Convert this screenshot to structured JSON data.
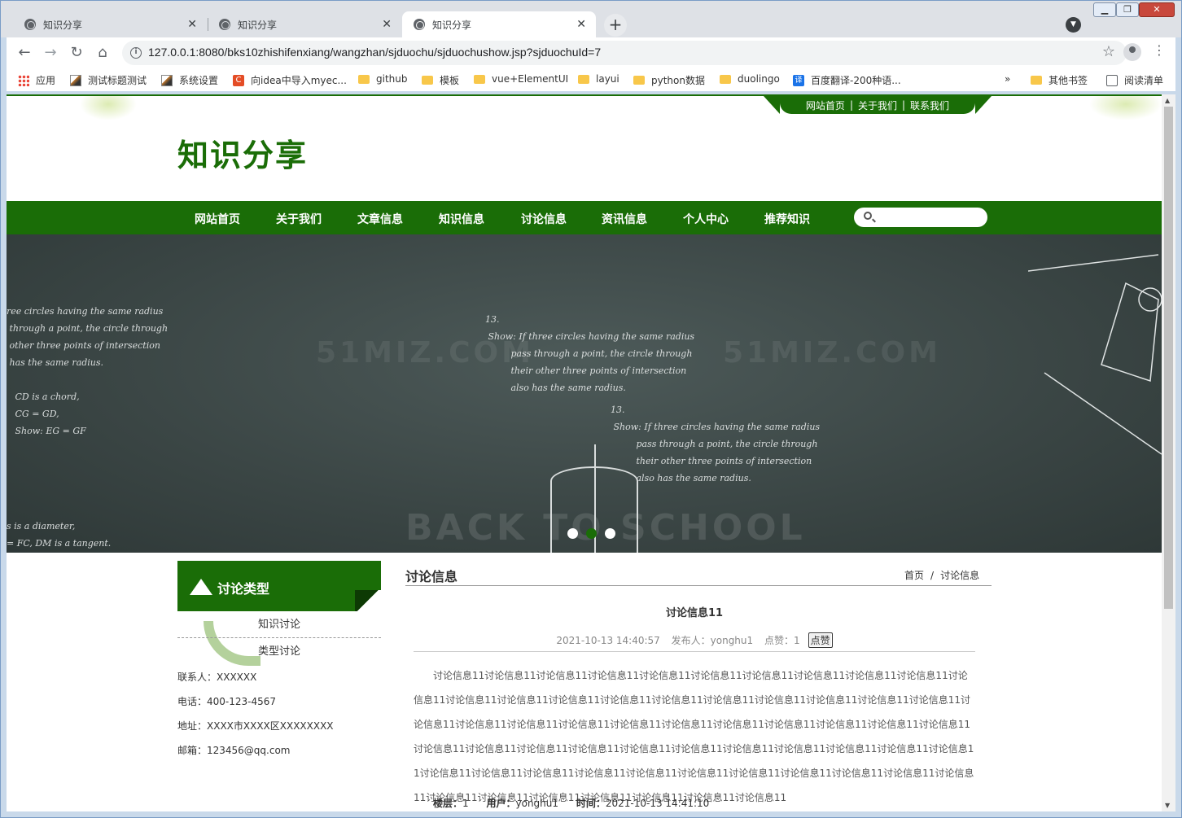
{
  "browser": {
    "tabs": [
      {
        "title": "知识分享"
      },
      {
        "title": "知识分享"
      },
      {
        "title": "知识分享"
      }
    ],
    "url": "127.0.0.1:8080/bks10zhishifenxiang/wangzhan/sjduochu/sjduochushow.jsp?sjduochuId=7",
    "bookmarks": [
      {
        "label": "应用",
        "icon": "apps-icon"
      },
      {
        "label": "测试标题测试",
        "icon": "image-icon"
      },
      {
        "label": "系统设置",
        "icon": "image-icon"
      },
      {
        "label": "向idea中导入myec...",
        "icon": "c-icon"
      },
      {
        "label": "github",
        "icon": "folder-icon"
      },
      {
        "label": "模板",
        "icon": "folder-icon"
      },
      {
        "label": "vue+ElementUI",
        "icon": "folder-icon"
      },
      {
        "label": "layui",
        "icon": "folder-icon"
      },
      {
        "label": "python数据",
        "icon": "folder-icon"
      },
      {
        "label": "duolingo",
        "icon": "folder-icon"
      },
      {
        "label": "百度翻译-200种语...",
        "icon": "translate-icon"
      }
    ],
    "overflow": "»",
    "other_bookmarks": "其他书签",
    "reading_list": "阅读清单"
  },
  "page": {
    "top_links": [
      "网站首页",
      "关于我们",
      "联系我们"
    ],
    "top_sep": "|",
    "site_title": "知识分享",
    "nav": [
      "网站首页",
      "关于我们",
      "文章信息",
      "知识信息",
      "讨论信息",
      "资讯信息",
      "个人中心",
      "推荐知识"
    ],
    "search_placeholder": "",
    "banner": {
      "chalk_left": "ree circles having the same radius\n through a point, the circle through\n other three points of intersection\n has the same radius.\n\n   CD is a chord,\n   CG = GD,\n   Show: EG = GF",
      "chalk_mid1": "13.\n Show: If three circles having the same radius\n         pass through a point, the circle through\n         their other three points of intersection\n         also has the same radius.",
      "chalk_mid2": "13.\n Show: If three circles having the same radius\n         pass through a point, the circle through\n         their other three points of intersection\n         also has the same radius.",
      "chalk_bottom_left": "s is a diameter,\n= FC, DM is a tangent.",
      "watermark1": "51MIZ.COM",
      "watermark2": "51MIZ.COM",
      "watermark3": "BACK TO SCHOOL",
      "slide_count": 3,
      "active_slide": 2
    },
    "sidebar": {
      "heading": "讨论类型",
      "items": [
        "知识讨论",
        "类型讨论"
      ],
      "contact": {
        "person": "联系人：XXXXXX",
        "phone": "电话：400-123-4567",
        "address": "地址：XXXX市XXXX区XXXXXXXX",
        "email": "邮箱：123456@qq.com"
      }
    },
    "main": {
      "heading": "讨论信息",
      "breadcrumb": [
        "首页",
        "讨论信息"
      ],
      "breadcrumb_sep": "/",
      "article_title": "讨论信息11",
      "date": "2021-10-13 14:40:57",
      "publisher": "发布人：yonghu1",
      "likes": "点赞：1",
      "like_button": "点赞",
      "body": "讨论信息11讨论信息11讨论信息11讨论信息11讨论信息11讨论信息11讨论信息11讨论信息11讨论信息11讨论信息11讨论信息11讨论信息11讨论信息11讨论信息11讨论信息11讨论信息11讨论信息11讨论信息11讨论信息11讨论信息11讨论信息11讨论信息11讨论信息11讨论信息11讨论信息11讨论信息11讨论信息11讨论信息11讨论信息11讨论信息11讨论信息11讨论信息11讨论信息11讨论信息11讨论信息11讨论信息11讨论信息11讨论信息11讨论信息11讨论信息11讨论信息11讨论信息11讨论信息11讨论信息11讨论信息11讨论信息11讨论信息11讨论信息11讨论信息11讨论信息11讨论信息11讨论信息11讨论信息11讨论信息11讨论信息11讨论信息11讨论信息11讨论信息11讨论信息11讨论信息11讨论信息11",
      "reply": {
        "floor_label": "楼层：",
        "floor": "1",
        "user_label": "用户：",
        "user": "yonghu1",
        "time_label": "时间：",
        "time": "2021-10-13 14:41:10"
      }
    },
    "colors": {
      "brand": "#1a6d07"
    }
  }
}
